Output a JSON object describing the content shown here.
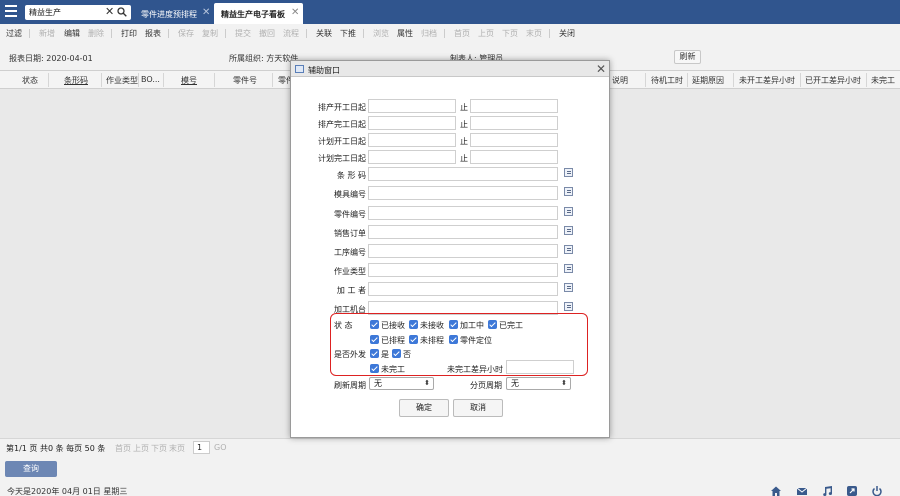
{
  "topbar": {
    "search_value": "精益生产",
    "tabs": [
      {
        "label": "零件进度预排程",
        "active": false
      },
      {
        "label": "精益生产电子看板",
        "active": true
      }
    ]
  },
  "toolbar": {
    "items": [
      {
        "label": "过滤",
        "enabled": true
      },
      {
        "label": "新增",
        "enabled": false
      },
      {
        "label": "编辑",
        "enabled": true
      },
      {
        "label": "删除",
        "enabled": false
      },
      {
        "label": "打印",
        "enabled": true
      },
      {
        "label": "报表",
        "enabled": true
      },
      {
        "label": "保存",
        "enabled": false
      },
      {
        "label": "复制",
        "enabled": false
      },
      {
        "label": "提交",
        "enabled": false
      },
      {
        "label": "撤回",
        "enabled": false
      },
      {
        "label": "流程",
        "enabled": false
      },
      {
        "label": "关联",
        "enabled": true
      },
      {
        "label": "下推",
        "enabled": true
      },
      {
        "label": "浏览",
        "enabled": false
      },
      {
        "label": "属性",
        "enabled": true
      },
      {
        "label": "归档",
        "enabled": false
      },
      {
        "label": "首页",
        "enabled": false
      },
      {
        "label": "上页",
        "enabled": false
      },
      {
        "label": "下页",
        "enabled": false
      },
      {
        "label": "末页",
        "enabled": false
      },
      {
        "label": "关闭",
        "enabled": true
      }
    ]
  },
  "info": {
    "report_date": "报表日期: 2020-04-01",
    "org": "所属组织: 方天软件",
    "maker": "制表人: 管理员",
    "refresh_label": "刷新"
  },
  "grid": {
    "columns": [
      "状态",
      "条形码",
      "作业类型",
      "BO...",
      "模号",
      "零件号",
      "零件",
      "说明",
      "待机工时",
      "延期原因",
      "未开工差异小时",
      "已开工差异小时",
      "未完工"
    ]
  },
  "pager": {
    "summary": "第1/1 页 共0 条 每页 50  条",
    "first": "首页",
    "prev": "上页",
    "next": "下页",
    "last": "末页",
    "page_value": "1",
    "go": "GO"
  },
  "query_label": "查询",
  "status": {
    "today": "今天是2020年  04月  01日  星期三"
  },
  "dialog": {
    "title": "辅助窗口",
    "range_fields": [
      {
        "label": "排产开工日起",
        "to": "止"
      },
      {
        "label": "排产完工日起",
        "to": "止"
      },
      {
        "label": "计划开工日起",
        "to": "止"
      },
      {
        "label": "计划完工日起",
        "to": "止"
      }
    ],
    "text_fields": [
      {
        "label": "条 形 码"
      },
      {
        "label": "模具编号"
      },
      {
        "label": "零件编号"
      },
      {
        "label": "销售订单"
      },
      {
        "label": "工序编号"
      },
      {
        "label": "作业类型"
      },
      {
        "label": "加 工 者"
      },
      {
        "label": "加工机台"
      }
    ],
    "status_label": "状      态",
    "status_row1": [
      {
        "label": "已接收",
        "checked": true
      },
      {
        "label": "未接收",
        "checked": true
      },
      {
        "label": "加工中",
        "checked": true
      },
      {
        "label": "已完工",
        "checked": true
      }
    ],
    "status_row2": [
      {
        "label": "已排程",
        "checked": true
      },
      {
        "label": "未排程",
        "checked": true
      },
      {
        "label": "零件定位",
        "checked": true
      }
    ],
    "outsource_label": "是否外发",
    "outsource": [
      {
        "label": "是",
        "checked": true
      },
      {
        "label": "否",
        "checked": true
      }
    ],
    "unfinished": {
      "label": "未完工",
      "checked": true
    },
    "unfinished_diff_label": "未完工差异小时",
    "refresh_period_label": "刷新周期",
    "refresh_period_value": "无",
    "page_period_label": "分页周期",
    "page_period_value": "无",
    "ok_label": "确定",
    "cancel_label": "取消"
  },
  "colors": {
    "topbar": "#30558e",
    "checkbox": "#3d78d8",
    "highlight": "#dd2222",
    "query_button": "#6d87b4"
  }
}
